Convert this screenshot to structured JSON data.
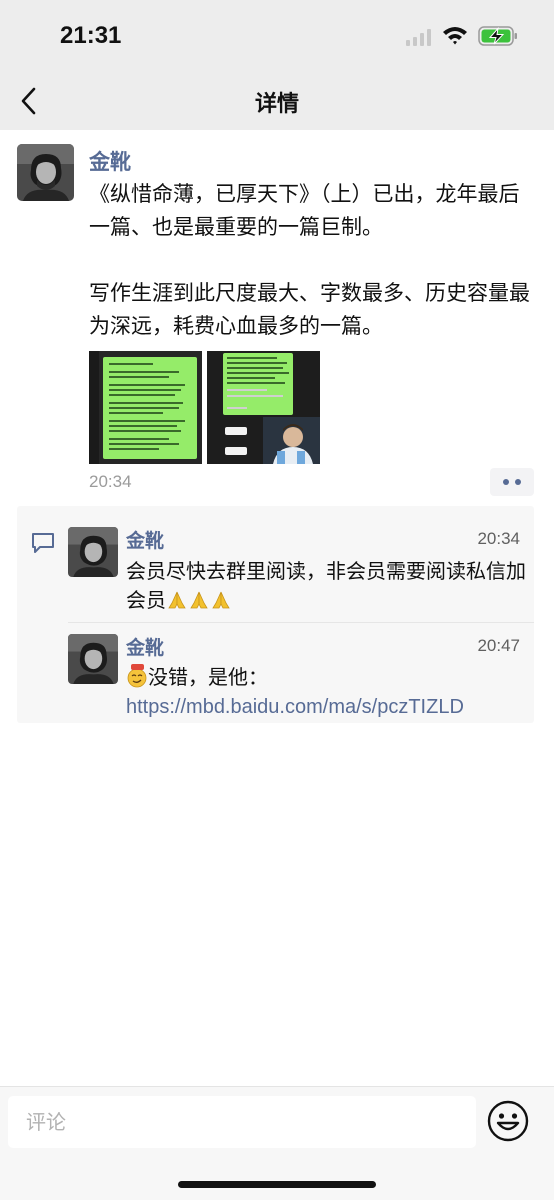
{
  "status_bar": {
    "time": "21:31"
  },
  "nav": {
    "title": "详情"
  },
  "post": {
    "author": "金靴",
    "paragraphs": [
      "《纵惜命薄，已厚天下》（上）已出，龙年最后一篇、也是最重要的一篇巨制。",
      "写作生涯到此尺度最大、字数最多、历史容量最为深远，耗费心血最多的一篇。"
    ],
    "time": "20:34",
    "images": [
      "chat-screenshot-thumbnail",
      "chat-screenshot-with-photo-thumbnail"
    ]
  },
  "comments": [
    {
      "author": "金靴",
      "time": "20:34",
      "text": "会员尽快去群里阅读，非会员需要阅读私信加会员",
      "trailing_emoji": [
        "folded-hands-emoji",
        "folded-hands-emoji",
        "folded-hands-emoji"
      ]
    },
    {
      "author": "金靴",
      "time": "20:47",
      "leading_emoji": "smirk-666-emoji",
      "text": "没错，是他：",
      "link": "https://mbd.baidu.com/ma/s/pczTIZLD"
    }
  ],
  "input": {
    "placeholder": "评论"
  },
  "colors": {
    "name_blue": "#576b95",
    "bar_gray": "#ededed",
    "comment_bg": "#f7f7f7",
    "chat_green": "#95ec69"
  }
}
